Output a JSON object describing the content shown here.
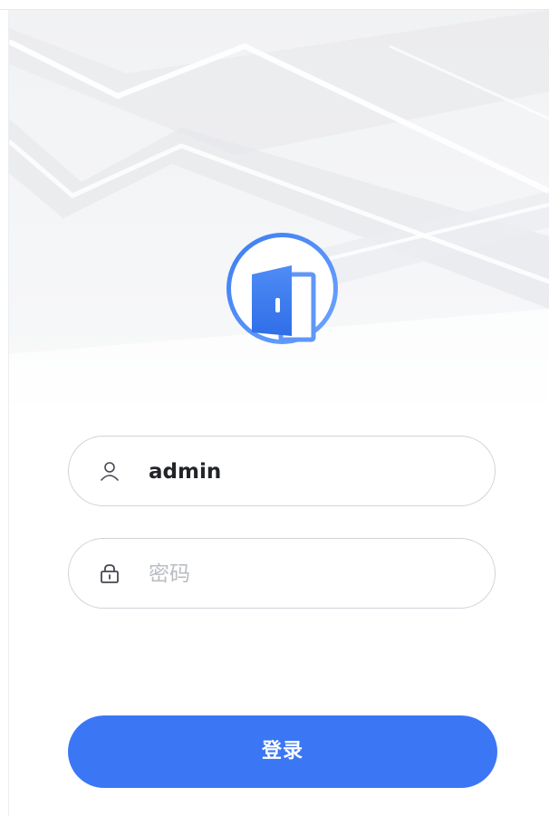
{
  "login": {
    "username_value": "admin",
    "password_placeholder": "密码",
    "submit_label": "登录"
  },
  "icons": {
    "logo": "door-logo-icon",
    "username": "user-icon",
    "password": "lock-icon"
  },
  "colors": {
    "primary": "#3b77f4",
    "logo_ring": "#3d7df2",
    "field_border": "#cfd3d9",
    "placeholder": "#b9bcc2",
    "text": "#222428"
  }
}
